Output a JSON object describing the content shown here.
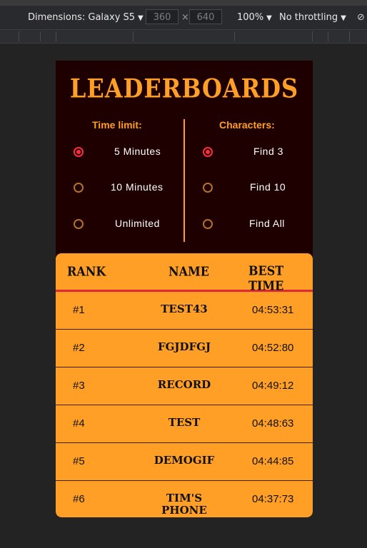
{
  "devtools": {
    "dimensions_label": "Dimensions: Galaxy S5",
    "width_value": "360",
    "times": "×",
    "height_value": "640",
    "zoom": "100%",
    "throttling": "No throttling"
  },
  "app": {
    "title": "LEADERBOARDS",
    "time_limit_label": "Time limit:",
    "characters_label": "Characters:",
    "time_options": [
      {
        "label": "5 Minutes",
        "checked": true
      },
      {
        "label": "10 Minutes",
        "checked": false
      },
      {
        "label": "Unlimited",
        "checked": false
      }
    ],
    "character_options": [
      {
        "label": "Find 3",
        "checked": true
      },
      {
        "label": "Find 10",
        "checked": false
      },
      {
        "label": "Find All",
        "checked": false
      }
    ],
    "table": {
      "headers": [
        "RANK",
        "NAME",
        "BEST TIME"
      ],
      "rows": [
        {
          "rank": "#1",
          "name": "TEST43",
          "time": "04:53:31"
        },
        {
          "rank": "#2",
          "name": "FGJDFGJ",
          "time": "04:52:80"
        },
        {
          "rank": "#3",
          "name": "RECORD",
          "time": "04:49:12"
        },
        {
          "rank": "#4",
          "name": "TEST",
          "time": "04:48:63"
        },
        {
          "rank": "#5",
          "name": "DEMOGIF",
          "time": "04:44:85"
        },
        {
          "rank": "#6",
          "name": "TIM'S PHONE",
          "time": "04:37:73"
        }
      ]
    }
  },
  "colors": {
    "accent": "#ff9f25",
    "radio_checked": "#ff2d3c",
    "background": "#1e0000"
  }
}
